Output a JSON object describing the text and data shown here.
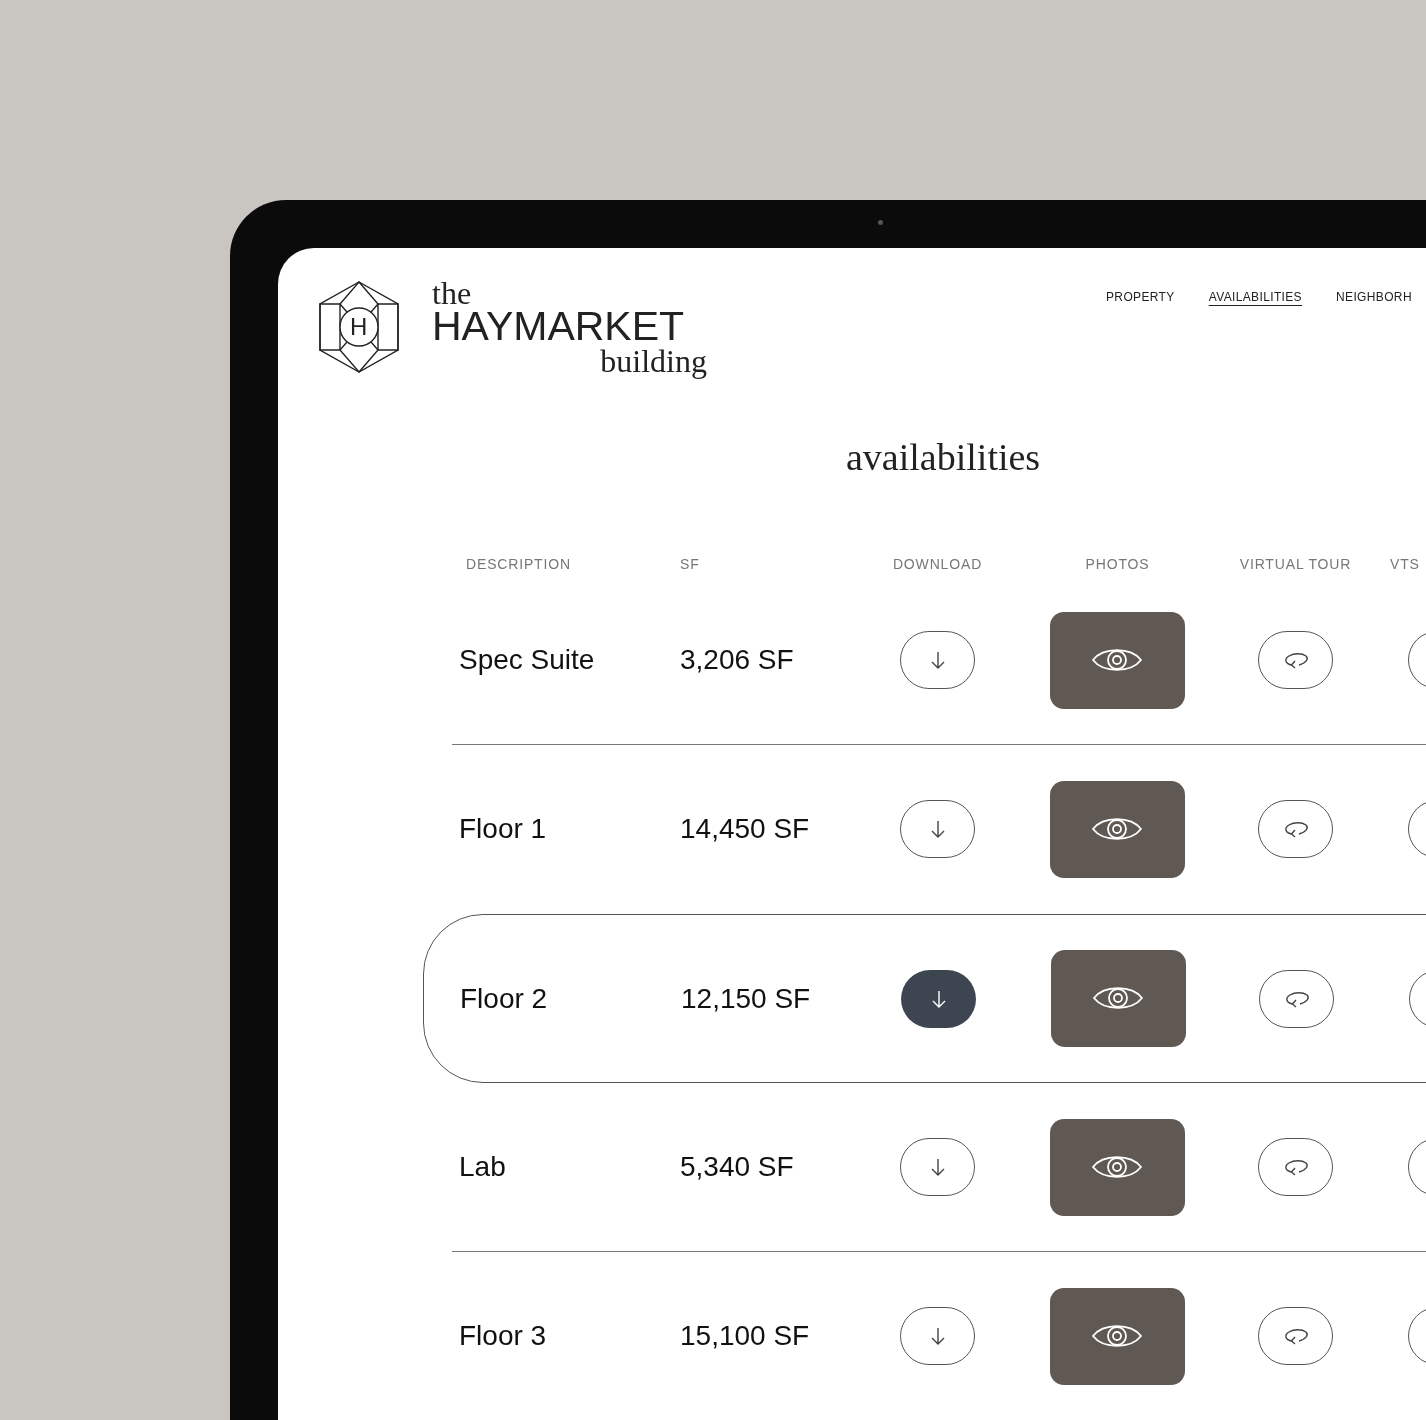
{
  "logo": {
    "mark": "H",
    "the": "the",
    "name": "HAYMARKET",
    "building": "building"
  },
  "nav": [
    {
      "label": "PROPERTY",
      "selected": false
    },
    {
      "label": "AVAILABILITIES",
      "selected": true
    },
    {
      "label": "NEIGHBORH",
      "selected": false
    }
  ],
  "title": "availabilities",
  "columns": [
    "DESCRIPTION",
    "SF",
    "DOWNLOAD",
    "PHOTOS",
    "VIRTUAL TOUR",
    "VTS"
  ],
  "rows": [
    {
      "description": "Spec Suite",
      "area": "3,206 SF",
      "selected": false
    },
    {
      "description": "Floor 1",
      "area": "14,450 SF",
      "selected": false
    },
    {
      "description": "Floor 2",
      "area": "12,150 SF",
      "selected": true
    },
    {
      "description": "Lab",
      "area": "5,340 SF",
      "selected": false
    },
    {
      "description": "Floor 3",
      "area": "15,100 SF",
      "selected": false
    }
  ]
}
